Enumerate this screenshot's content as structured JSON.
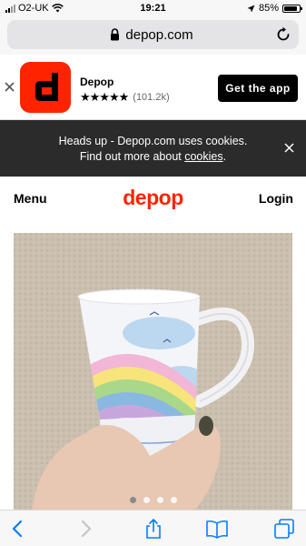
{
  "status_bar": {
    "carrier": "O2-UK",
    "time": "19:21",
    "battery_percent": "85%",
    "battery_level": 0.85
  },
  "url_bar": {
    "url": "depop.com"
  },
  "app_banner": {
    "app_name": "Depop",
    "stars": "★★★★★",
    "rating_count": "(101.2k)",
    "cta_label": "Get the app",
    "icon_letter": "d"
  },
  "cookie_banner": {
    "line1": "Heads up - Depop.com uses cookies.",
    "line2_prefix": "Find out more about ",
    "link_text": "cookies",
    "line2_suffix": "."
  },
  "header": {
    "menu_label": "Menu",
    "logo_text": "depop",
    "login_label": "Login"
  },
  "carousel": {
    "total_slides": 4,
    "active_slide": 1
  },
  "colors": {
    "brand_red": "#ff2300",
    "ios_blue": "#0a7aff",
    "cookie_bg": "#2b2b2b"
  },
  "icons": {
    "toolbar": [
      "back-chevron-icon",
      "forward-chevron-icon",
      "share-icon",
      "bookmarks-icon",
      "tabs-icon"
    ]
  }
}
